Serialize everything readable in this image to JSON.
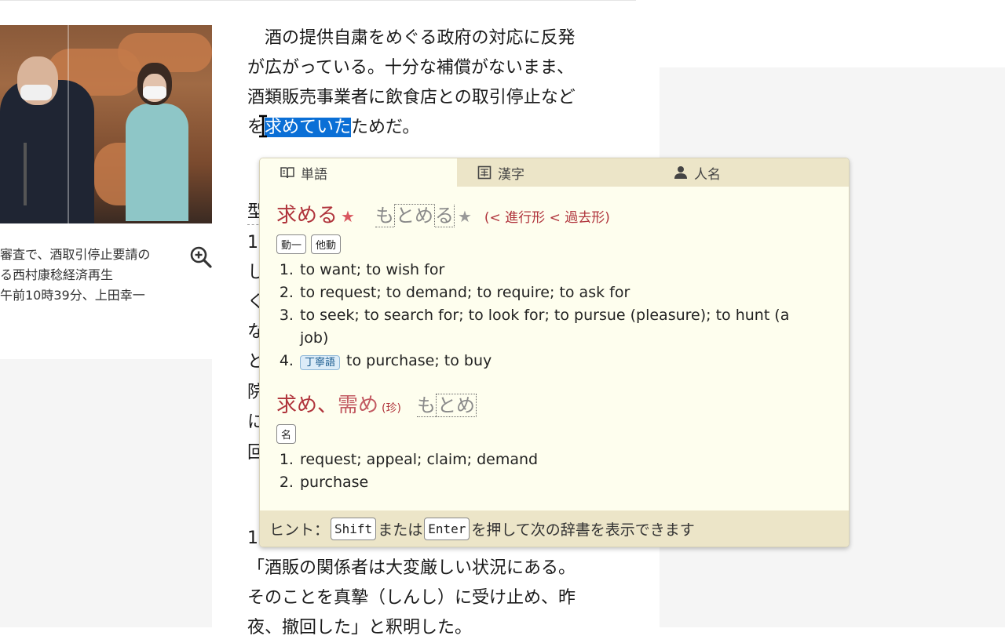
{
  "caption": {
    "lines": [
      "審査で、酒取引停止要請の",
      "る西村康稔経済再生",
      "午前10時39分、上田幸一"
    ]
  },
  "article": {
    "lines": [
      "　酒の提供自粛をめぐる政府の対応に反発",
      "が広がっている。十分な補償がないまま、",
      "酒類販売事業者に飲食店との取引停止など"
    ],
    "line4_before": "を",
    "line4_selected": "求めていた",
    "line4_after": "ためだ。",
    "gutter_chars": [
      "型",
      "1",
      "し",
      "く",
      "な",
      "と",
      "院",
      "に",
      "回"
    ],
    "bottom_lines": [
      "1",
      "「酒販の関係者は大変厳しい状況にある。",
      "そのことを真摯（しんし）に受け止め、昨",
      "夜、撤回した」と釈明した。"
    ]
  },
  "popup": {
    "tabs": {
      "words": "単語",
      "kanji": "漢字",
      "names": "人名"
    },
    "entry1": {
      "kanji": "求める",
      "kana_parts": [
        "も",
        "とめ",
        "る"
      ],
      "deinflection": "(< 進行形 < 過去形)",
      "tags": [
        "動一",
        "他動"
      ],
      "senses": [
        "to want; to wish for",
        "to request; to demand; to require; to ask for",
        "to seek; to search for; to look for; to pursue (pleasure); to hunt (a job)",
        "to purchase; to buy"
      ],
      "sense4_tag": "丁寧語"
    },
    "entry2": {
      "kanji1": "求め",
      "sep": "、",
      "kanji2": "需め",
      "rare": "(珍)",
      "kana_parts": [
        "も",
        "とめ"
      ],
      "tags": [
        "名"
      ],
      "senses": [
        "request; appeal; claim; demand",
        "purchase"
      ]
    },
    "hint": {
      "prefix": "ヒント：",
      "key1": "Shift",
      "middle": "または",
      "key2": "Enter",
      "suffix": "を押して次の辞書を表示できます"
    }
  },
  "colors": {
    "headword": "#b0343c",
    "popup_bg": "#fefeee",
    "tab_bar": "#ece5c8",
    "selection": "#0a6fd6"
  }
}
